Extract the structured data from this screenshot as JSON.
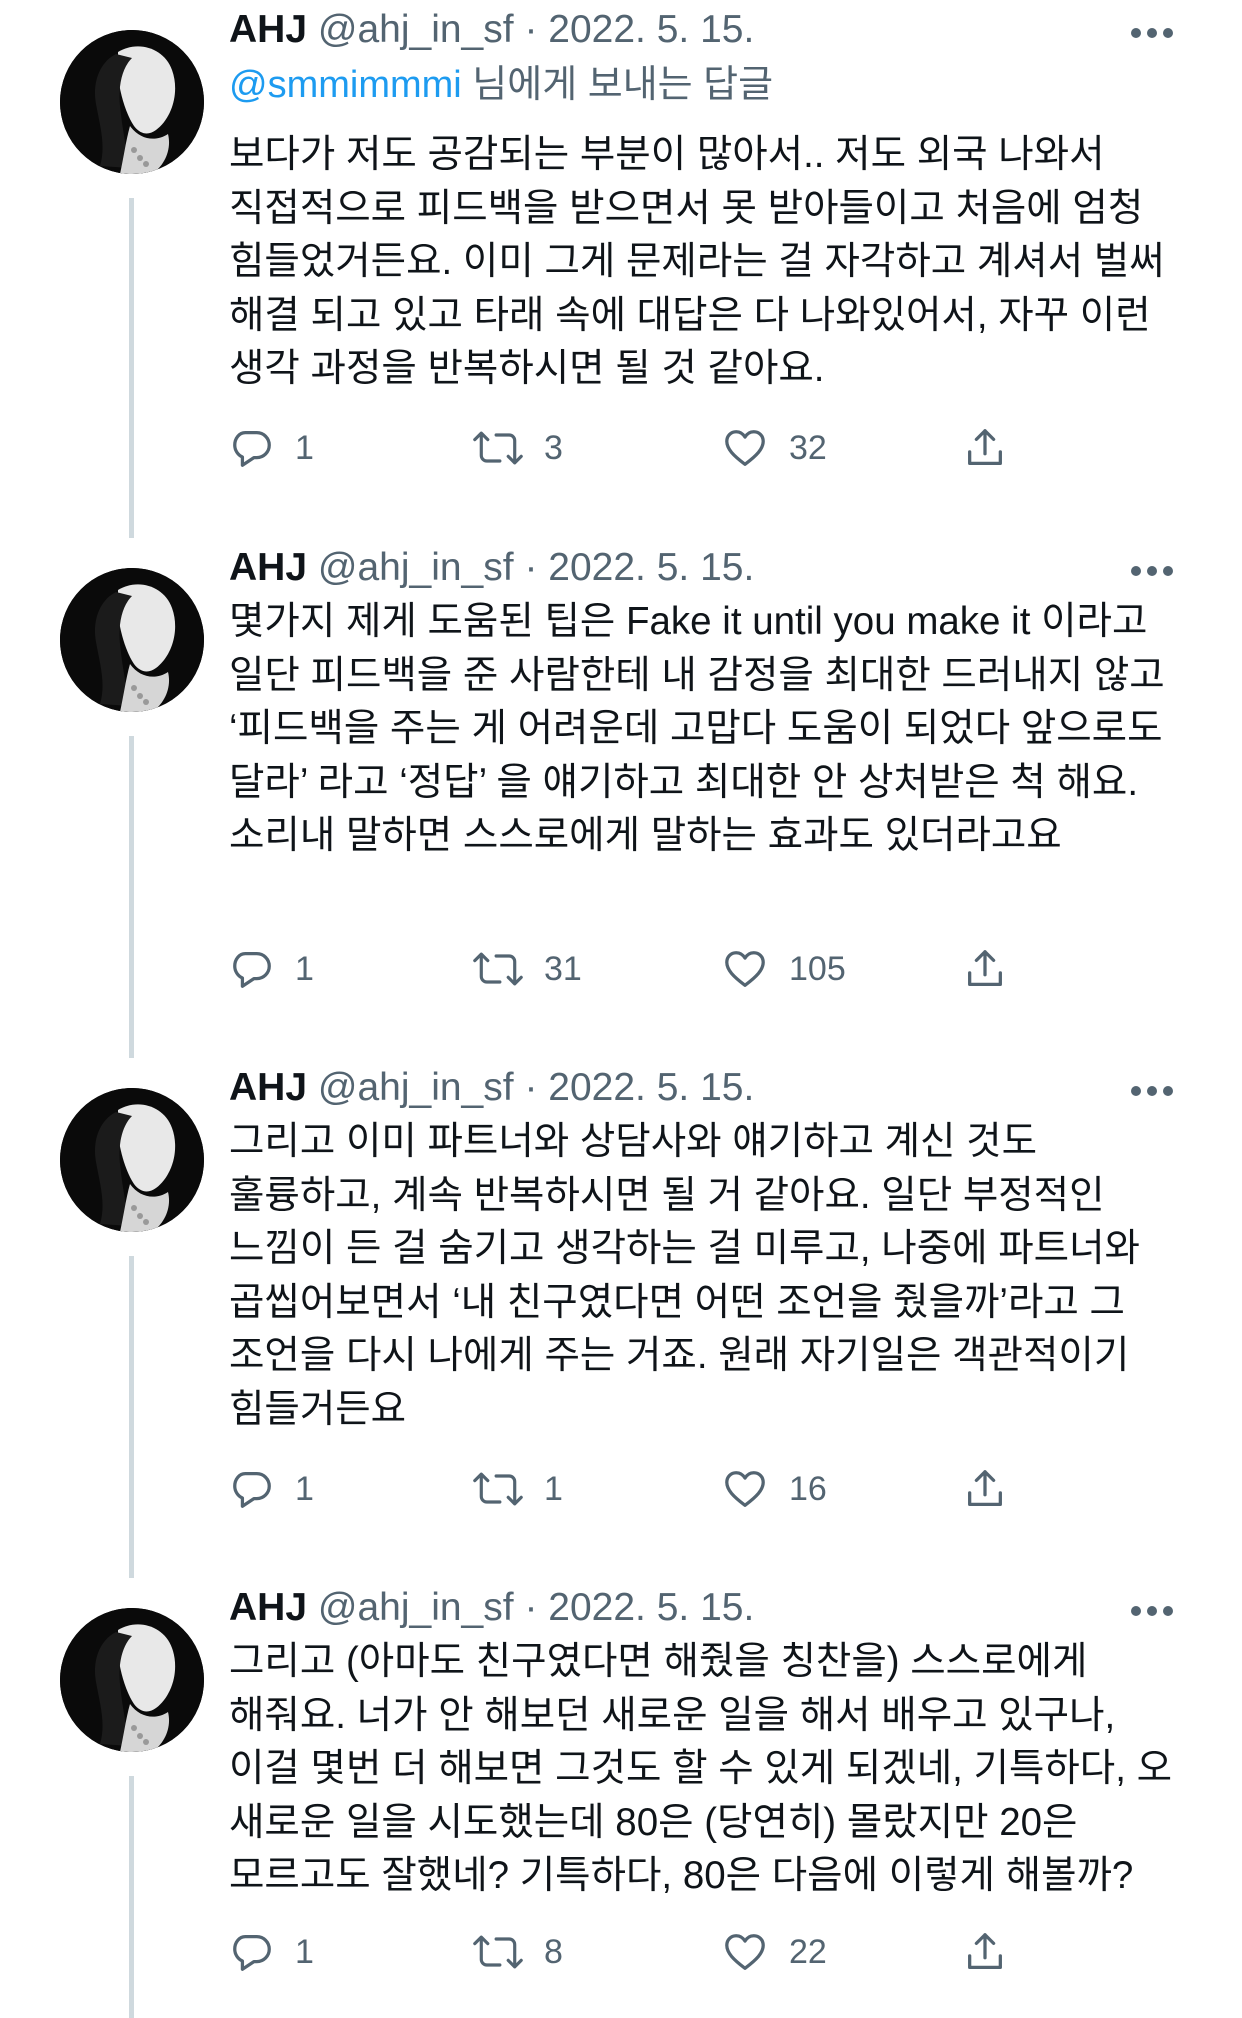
{
  "tweets": [
    {
      "name": "AHJ",
      "handle": "@ahj_in_sf",
      "separator": "·",
      "date": "2022. 5. 15.",
      "replying_mention": "@smmimmmi",
      "replying_text": " 님에게 보내는 답글",
      "text": "보다가 저도 공감되는 부분이 많아서.. 저도 외국 나와서 직접적으로 피드백을 받으면서 못 받아들이고 처음에 엄청 힘들었거든요. 이미 그게 문제라는 걸 자각하고 계셔서 벌써 해결 되고 있고 타래 속에 대답은 다 나와있어서, 자꾸 이런 생각 과정을 반복하시면 될 것 같아요.",
      "replies": "1",
      "retweets": "3",
      "likes": "32"
    },
    {
      "name": "AHJ",
      "handle": "@ahj_in_sf",
      "separator": "·",
      "date": "2022. 5. 15.",
      "text": "몇가지 제게 도움된 팁은 Fake it until you make it 이라고 일단 피드백을 준 사람한테 내 감정을 최대한 드러내지 않고 ‘피드백을 주는 게 어려운데 고맙다 도움이 되었다 앞으로도 달라’ 라고 ‘정답’ 을 얘기하고 최대한 안 상처받은 척 해요. 소리내 말하면 스스로에게 말하는 효과도 있더라고요",
      "replies": "1",
      "retweets": "31",
      "likes": "105"
    },
    {
      "name": "AHJ",
      "handle": "@ahj_in_sf",
      "separator": "·",
      "date": "2022. 5. 15.",
      "text": "그리고 이미 파트너와 상담사와 얘기하고 계신 것도 훌륭하고, 계속 반복하시면 될 거 같아요. 일단 부정적인 느낌이 든 걸 숨기고 생각하는 걸 미루고, 나중에 파트너와 곱씹어보면서 ‘내 친구였다면 어떤 조언을 줬을까’라고 그 조언을 다시 나에게 주는 거죠. 원래 자기일은 객관적이기 힘들거든요",
      "replies": "1",
      "retweets": "1",
      "likes": "16"
    },
    {
      "name": "AHJ",
      "handle": "@ahj_in_sf",
      "separator": "·",
      "date": "2022. 5. 15.",
      "text": "그리고 (아마도 친구였다면 해줬을 칭찬을) 스스로에게 해줘요. 너가 안 해보던 새로운 일을 해서 배우고 있구나, 이걸 몇번 더 해보면 그것도 할 수 있게 되겠네, 기특하다, 오 새로운 일을 시도했는데 80은 (당연히) 몰랐지만 20은 모르고도 잘했네? 기특하다, 80은 다음에 이렇게 해볼까?",
      "replies": "1",
      "retweets": "8",
      "likes": "22"
    }
  ],
  "icons": {
    "more": "more-horizontal-icon",
    "reply": "reply-icon",
    "retweet": "retweet-icon",
    "like": "heart-icon",
    "share": "share-icon"
  },
  "colors": {
    "text": "#0f1419",
    "secondary": "#536471",
    "mention": "#1d9bf0",
    "thread_line": "#cfd9de"
  }
}
